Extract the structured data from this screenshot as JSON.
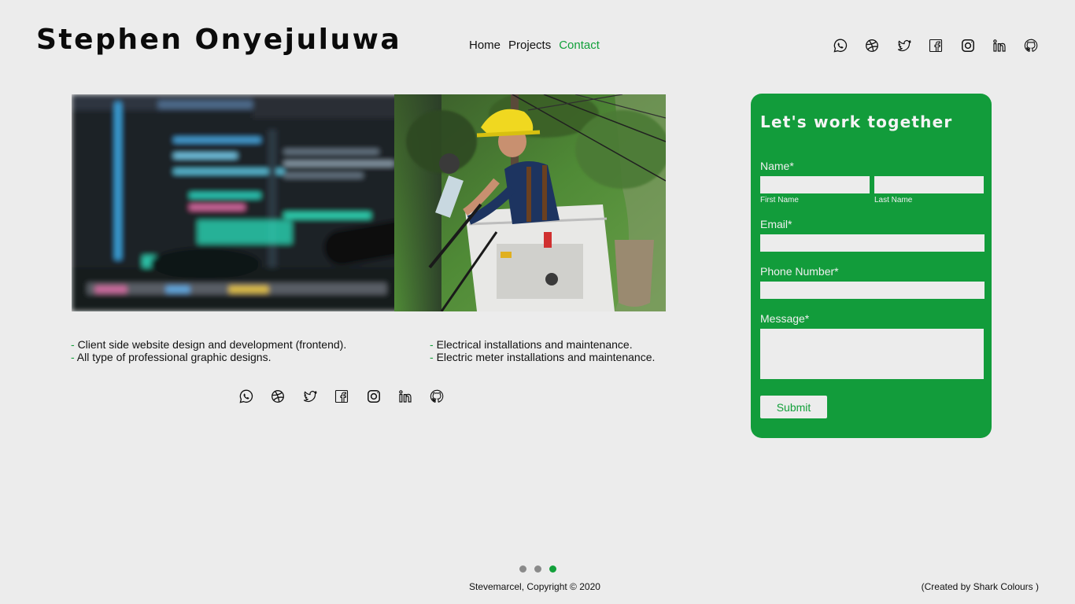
{
  "brand": {
    "name": "Stephen Onyejuluwa"
  },
  "nav": {
    "items": [
      "Home",
      "Projects",
      "Contact"
    ],
    "active": "Contact"
  },
  "social": [
    "whatsapp-icon",
    "dribbble-icon",
    "twitter-icon",
    "facebook-icon",
    "instagram-icon",
    "linkedin-icon",
    "github-icon"
  ],
  "services": {
    "left": [
      "Client side website design and development (frontend).",
      "All type of professional graphic designs."
    ],
    "right": [
      "Electrical installations and maintenance.",
      "Electric meter installations and maintenance."
    ],
    "bullet": "- "
  },
  "contact": {
    "title": "Let's work together",
    "name_label": "Name*",
    "first_name_label": "First Name",
    "last_name_label": "Last Name",
    "email_label": "Email*",
    "phone_label": "Phone Number*",
    "message_label": "Message*",
    "submit_label": "Submit"
  },
  "carousel": {
    "count": 3,
    "active_index": 2
  },
  "footer": {
    "copyright": "Stevemarcel, Copyright © 2020",
    "credit": "(Created by Shark Colours )"
  },
  "colors": {
    "accent": "#12a03a",
    "card": "#129c3b",
    "background": "#ececec",
    "text": "#111111"
  }
}
